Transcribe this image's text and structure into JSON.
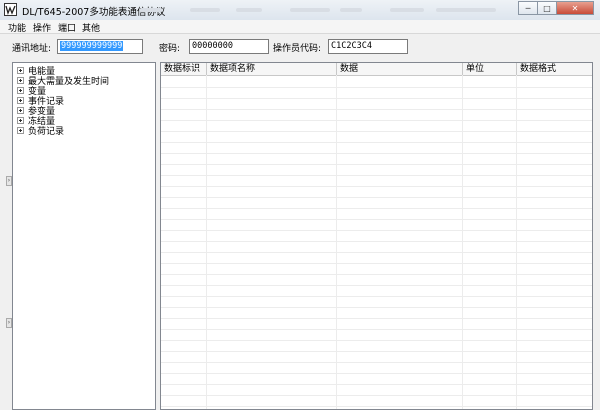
{
  "window": {
    "title": "DL/T645-2007多功能表通信协议",
    "buttons": {
      "minimize": "─",
      "maximize": "□",
      "close": "✕"
    }
  },
  "menu": [
    "功能",
    "操作",
    "端口",
    "其他"
  ],
  "form": {
    "address_label": "通讯地址:",
    "address_value": "999999999999",
    "password_label": "密码:",
    "password_value": "00000000",
    "operator_label": "操作员代码:",
    "operator_value": "C1C2C3C4"
  },
  "tree": [
    "电能量",
    "最大需量及发生时间",
    "变量",
    "事件记录",
    "参变量",
    "冻结量",
    "负荷记录"
  ],
  "table": {
    "columns": [
      "数据标识",
      "数据项名称",
      "数据",
      "单位",
      "数据格式"
    ]
  }
}
